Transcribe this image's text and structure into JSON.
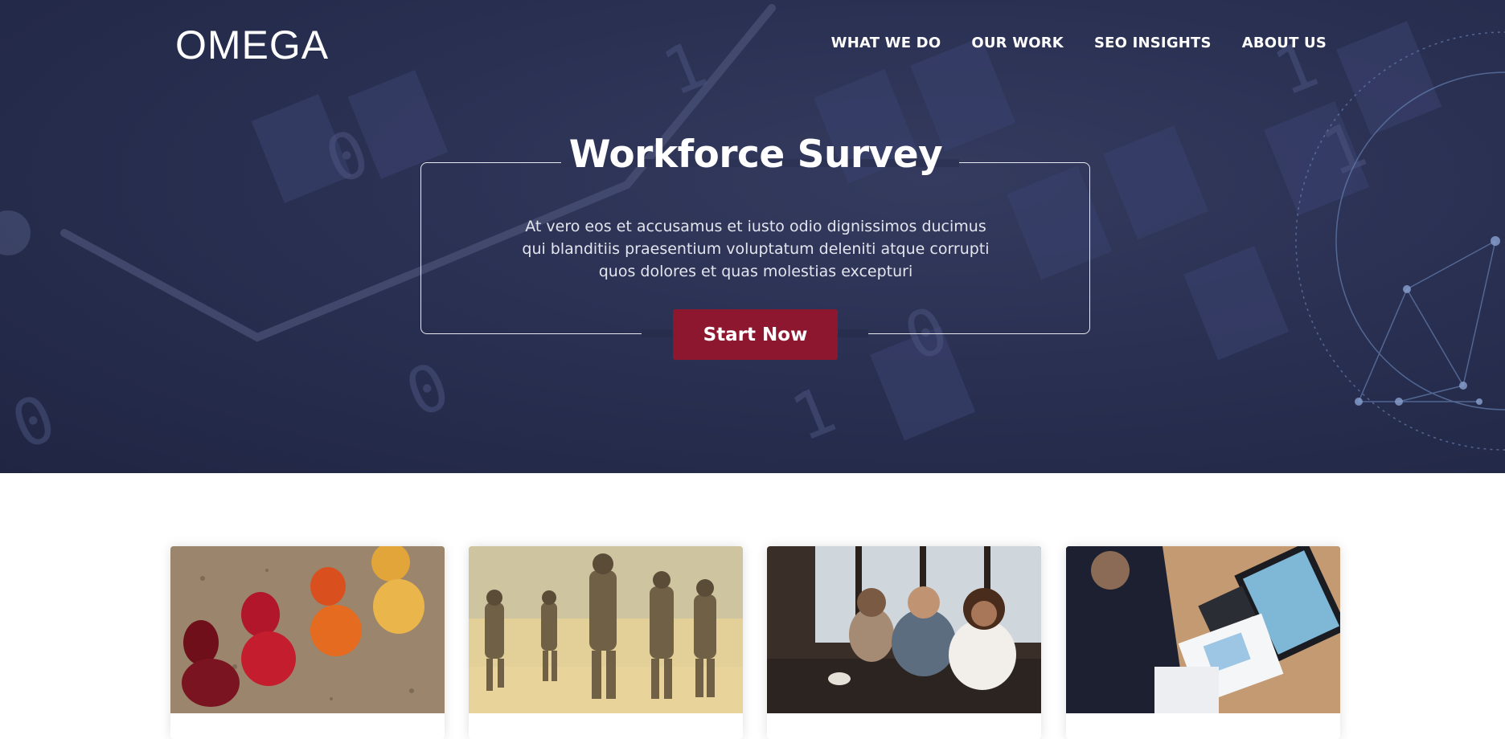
{
  "header": {
    "logo": "OMEGA",
    "nav": [
      "WHAT WE DO",
      "OUR WORK",
      "SEO INSIGHTS",
      "ABOUT US"
    ]
  },
  "hero": {
    "title": "Workforce Survey",
    "text": "At vero eos et accusamus et iusto odio dignissimos ducimus qui blanditiis praesentium voluptatum deleniti atque corrupti quos dolores et quas molestias excepturi",
    "cta": "Start Now"
  },
  "cards": [
    {
      "image": "colorful-game-pawns-photo"
    },
    {
      "image": "soldiers-in-desert-photo"
    },
    {
      "image": "team-meeting-photo"
    },
    {
      "image": "business-charts-desk-photo"
    }
  ],
  "colors": {
    "hero_bg": "#272d4c",
    "accent": "#8e1730",
    "text_light": "#e3e5ee"
  }
}
